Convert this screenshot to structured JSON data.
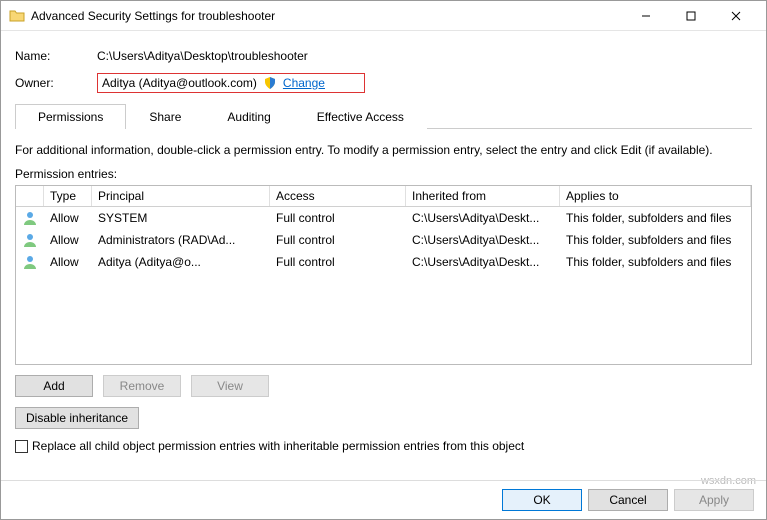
{
  "window": {
    "title": "Advanced Security Settings for troubleshooter"
  },
  "info": {
    "name_label": "Name:",
    "name_value": "C:\\Users\\Aditya\\Desktop\\troubleshooter",
    "owner_label": "Owner:",
    "owner_value": "Aditya (Aditya@outlook.com)",
    "change_link": "Change"
  },
  "tabs": {
    "permissions": "Permissions",
    "share": "Share",
    "auditing": "Auditing",
    "effective": "Effective Access"
  },
  "help_text": "For additional information, double-click a permission entry. To modify a permission entry, select the entry and click Edit (if available).",
  "perm_label": "Permission entries:",
  "columns": {
    "type": "Type",
    "principal": "Principal",
    "access": "Access",
    "inherited": "Inherited from",
    "applies": "Applies to"
  },
  "entries": [
    {
      "type": "Allow",
      "principal": "SYSTEM",
      "access": "Full control",
      "inherited": "C:\\Users\\Aditya\\Deskt...",
      "applies": "This folder, subfolders and files"
    },
    {
      "type": "Allow",
      "principal": "Administrators (RAD\\Ad...",
      "access": "Full control",
      "inherited": "C:\\Users\\Aditya\\Deskt...",
      "applies": "This folder, subfolders and files"
    },
    {
      "type": "Allow",
      "principal": "Aditya (Aditya@o...",
      "access": "Full control",
      "inherited": "C:\\Users\\Aditya\\Deskt...",
      "applies": "This folder, subfolders and files"
    }
  ],
  "buttons": {
    "add": "Add",
    "remove": "Remove",
    "view": "View",
    "disable_inh": "Disable inheritance",
    "ok": "OK",
    "cancel": "Cancel",
    "apply": "Apply"
  },
  "checkbox_label": "Replace all child object permission entries with inheritable permission entries from this object",
  "watermark": "wsxdn.com"
}
